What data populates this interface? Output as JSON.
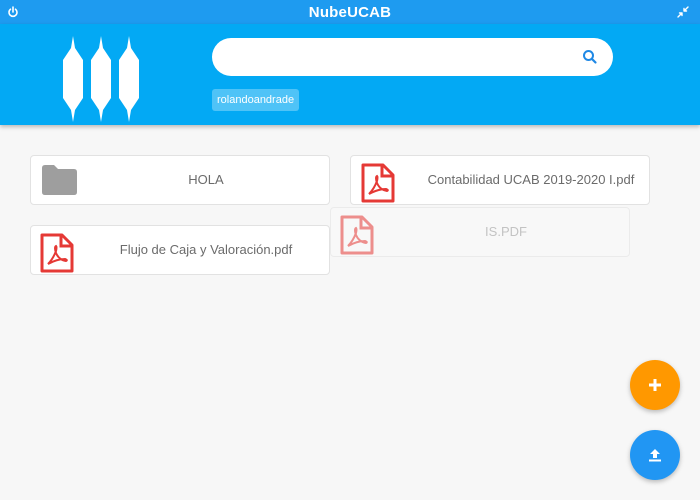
{
  "window": {
    "title": "NubeUCAB"
  },
  "header": {
    "search": {
      "value": "",
      "placeholder": ""
    },
    "user_chip": "rolandoandrade"
  },
  "items": [
    {
      "name": "HOLA",
      "type": "folder"
    },
    {
      "name": "Contabilidad UCAB 2019-2020 I.pdf",
      "type": "pdf"
    },
    {
      "name": "Flujo de Caja y Valoración.pdf",
      "type": "pdf"
    },
    {
      "name": "IS.PDF",
      "type": "pdf"
    }
  ],
  "icons": {
    "power": "power-icon",
    "restore": "restore-icon",
    "search": "search-icon",
    "folder": "folder-icon",
    "pdf": "pdf-file-icon",
    "add": "plus-icon",
    "upload": "upload-icon"
  },
  "colors": {
    "titlebar": "#1e9bf0",
    "header": "#03a9f4",
    "fab_add": "#ff9800",
    "fab_upload": "#2196f3",
    "pdf_red": "#e53935",
    "folder_gray": "#9e9e9e"
  }
}
